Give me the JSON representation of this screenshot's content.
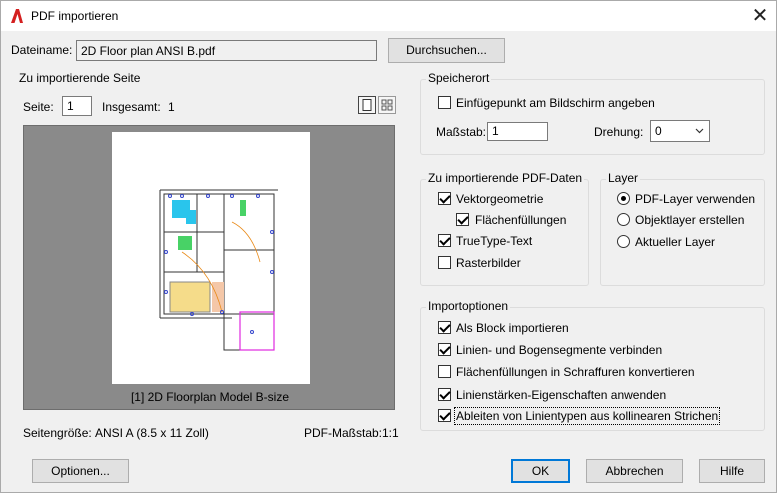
{
  "window": {
    "title": "PDF importieren",
    "close_glyph": "✕"
  },
  "file": {
    "label": "Dateiname:",
    "value": "2D Floor plan ANSI B.pdf",
    "browse_label": "Durchsuchen..."
  },
  "page_section": {
    "legend": "Zu importierende Seite",
    "page_label": "Seite:",
    "page_value": "1",
    "total_label": "Insgesamt:",
    "total_value": "1",
    "preview_caption": "[1] 2D Floorplan Model B-size",
    "size_label": "Seitengröße:",
    "size_value": "ANSI A (8.5 x 11 Zoll)",
    "scale_label": "PDF-Maßstab:",
    "scale_value": "1:1",
    "view_icons": [
      "single-page-view-icon",
      "thumbnail-grid-view-icon"
    ]
  },
  "location": {
    "legend": "Speicherort",
    "insertion_label": "Einfügepunkt am Bildschirm angeben",
    "insertion_checked": false,
    "scale_label": "Maßstab:",
    "scale_value": "1",
    "rotation_label": "Drehung:",
    "rotation_value": "0"
  },
  "pdf_data": {
    "legend": "Zu importierende PDF-Daten",
    "items": [
      {
        "label": "Vektorgeometrie",
        "checked": true
      },
      {
        "label": "Flächenfüllungen",
        "checked": true
      },
      {
        "label": "TrueType-Text",
        "checked": true
      },
      {
        "label": "Rasterbilder",
        "checked": false
      }
    ]
  },
  "layer": {
    "legend": "Layer",
    "options": [
      {
        "label": "PDF-Layer verwenden",
        "selected": true
      },
      {
        "label": "Objektlayer erstellen",
        "selected": false
      },
      {
        "label": "Aktueller Layer",
        "selected": false
      }
    ]
  },
  "import_options": {
    "legend": "Importoptionen",
    "items": [
      {
        "label": "Als Block importieren",
        "checked": true
      },
      {
        "label": "Linien- und Bogensegmente verbinden",
        "checked": true
      },
      {
        "label": "Flächenfüllungen in Schraffuren konvertieren",
        "checked": false
      },
      {
        "label": "Linienstärken-Eigenschaften anwenden",
        "checked": true
      },
      {
        "label": "Ableiten von Linientypen aus kollinearen Strichen",
        "checked": true
      }
    ]
  },
  "buttons": {
    "options": "Optionen...",
    "ok": "OK",
    "cancel": "Abbrechen",
    "help": "Hilfe"
  },
  "colors": {
    "accent": "#0078d7",
    "app_icon": "#d42020"
  }
}
